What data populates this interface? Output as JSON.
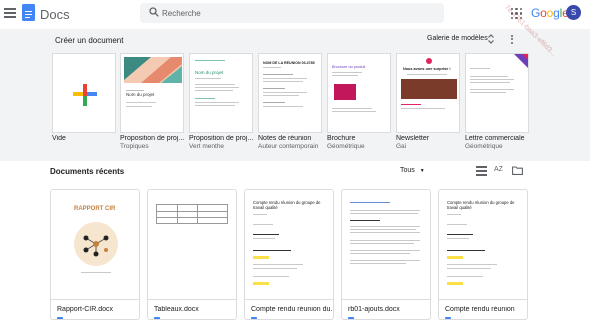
{
  "header": {
    "app_name": "Docs",
    "search_placeholder": "Recherche",
    "google_logo": "Google",
    "avatar_letter": "S",
    "google_colors": [
      "#4285f4",
      "#ea4335",
      "#fbbc05",
      "#4285f4",
      "#34a853",
      "#ea4335"
    ]
  },
  "templates": {
    "section_title": "Créer un document",
    "gallery_label": "Galerie de modèles",
    "items": [
      {
        "name": "Vide",
        "subtitle": ""
      },
      {
        "name": "Proposition de proj...",
        "subtitle": "Tropiques"
      },
      {
        "name": "Proposition de proj...",
        "subtitle": "Vert menthe"
      },
      {
        "name": "Notes de réunion",
        "subtitle": "Auteur contemporain"
      },
      {
        "name": "Brochure",
        "subtitle": "Géométrique"
      },
      {
        "name": "Newsletter",
        "subtitle": "Gai"
      },
      {
        "name": "Lettre commerciale",
        "subtitle": "Géométrique"
      }
    ],
    "thumb_texts": {
      "project_name": "Nom du projet",
      "meeting_title": "NOM DE LA RÉUNION 03.4785",
      "brochure_title": "Brochure du produit",
      "newsletter_title": "Nous avons une surprise !"
    }
  },
  "recent": {
    "section_title": "Documents récents",
    "owner_filter": "Tous",
    "sort_label": "AZ",
    "docs": [
      {
        "name": "Rapport-CIR.docx",
        "preview_title": "RAPPORT CIR"
      },
      {
        "name": "Tableaux.docx",
        "preview_title": ""
      },
      {
        "name": "Compte rendu réunion du...",
        "preview_title": "Compte rendu réunion du groupe de travail qualité"
      },
      {
        "name": "rb01-ajouts.docx",
        "preview_title": ""
      },
      {
        "name": "Compte rendu réunion",
        "preview_title": "Compte rendu réunion du groupe de travail qualité"
      }
    ]
  },
  "watermark": "7e-4761-baa3-ef6d3..."
}
